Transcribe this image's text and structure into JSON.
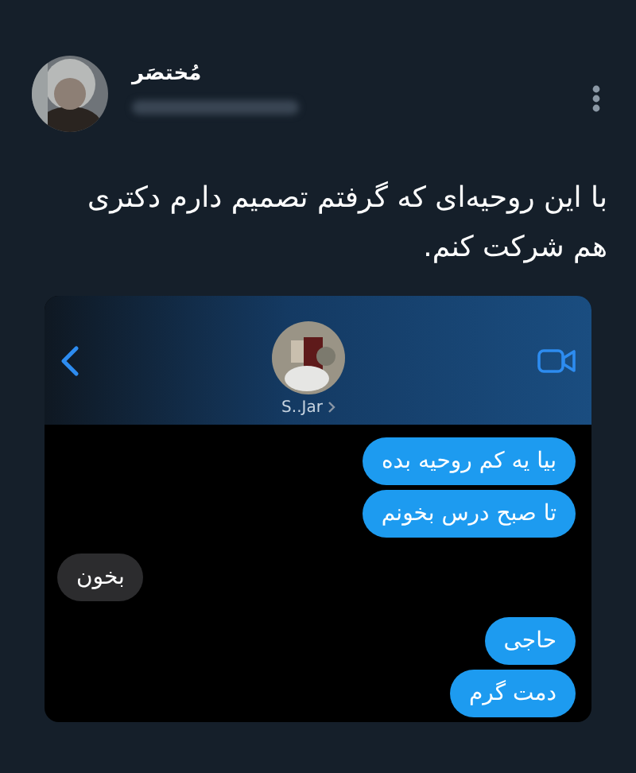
{
  "author": {
    "name": "مُختصَر"
  },
  "tweet": {
    "text": "با این روحیه‌ای که گرفتم تصمیم دارم دکتری هم شرکت کنم."
  },
  "chat": {
    "contact": {
      "name": "S..Jar"
    },
    "messages": [
      {
        "kind": "sent",
        "text": "بیا یه کم روحیه بده"
      },
      {
        "kind": "sent",
        "text": "تا صبح درس بخونم"
      },
      {
        "kind": "received",
        "text": "بخون"
      },
      {
        "kind": "sent",
        "text": "حاجی"
      },
      {
        "kind": "sent",
        "text": "دمت گرم"
      }
    ]
  }
}
